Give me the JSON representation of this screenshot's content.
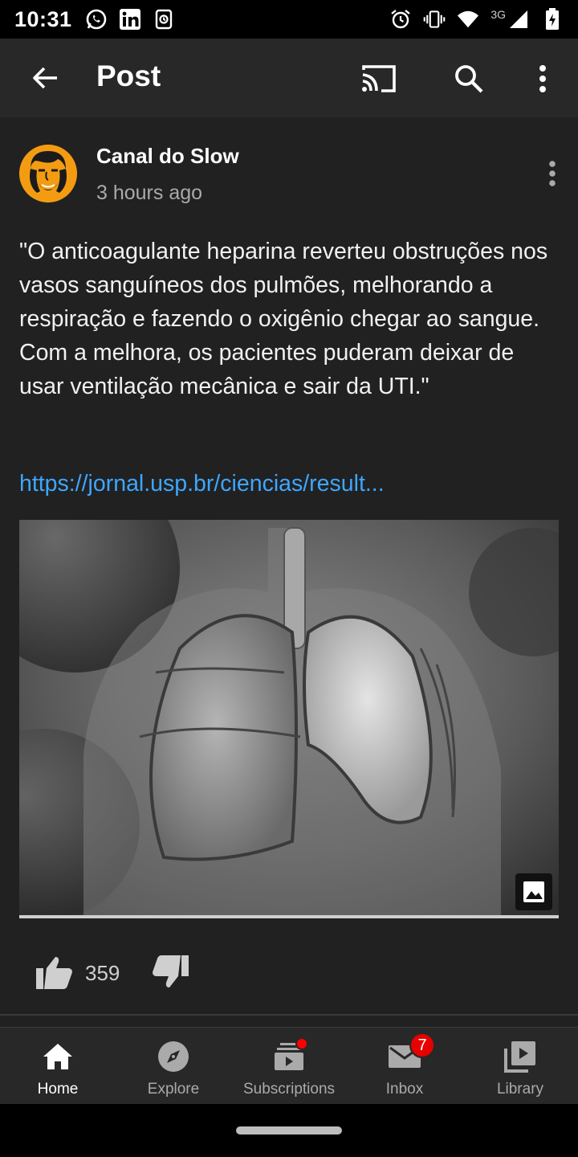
{
  "status_bar": {
    "time": "10:31",
    "left_icons": [
      "whatsapp-icon",
      "linkedin-icon",
      "app-notification-icon"
    ],
    "right_icons": [
      "alarm-icon",
      "vibrate-icon",
      "wifi-icon",
      "cellular-icon",
      "battery-icon"
    ],
    "network": "3G"
  },
  "app_bar": {
    "title": "Post"
  },
  "post": {
    "channel_name": "Canal do Slow",
    "time_ago": "3 hours ago",
    "text": "\"O anticoagulante heparina reverteu obstruções nos vasos sanguíneos dos pulmões, melhorando a respiração e fazendo o oxigênio chegar ao sangue. Com a melhora, os pacientes puderam deixar de usar ventilação mecânica e sair da UTI.\"",
    "link": "https://jornal.usp.br/ciencias/result...",
    "like_count": "359"
  },
  "bottom_nav": {
    "items": [
      {
        "label": "Home",
        "icon": "home-icon",
        "active": true
      },
      {
        "label": "Explore",
        "icon": "compass-icon"
      },
      {
        "label": "Subscriptions",
        "icon": "subscriptions-icon",
        "badge": "dot"
      },
      {
        "label": "Inbox",
        "icon": "mail-icon",
        "badge": "7"
      },
      {
        "label": "Library",
        "icon": "library-icon"
      }
    ]
  },
  "colors": {
    "background": "#212121",
    "app_bar": "#282828",
    "link": "#3ea6ff",
    "secondary_text": "#aaaaaa",
    "badge": "#ff0000",
    "avatar": "#f39c12"
  }
}
